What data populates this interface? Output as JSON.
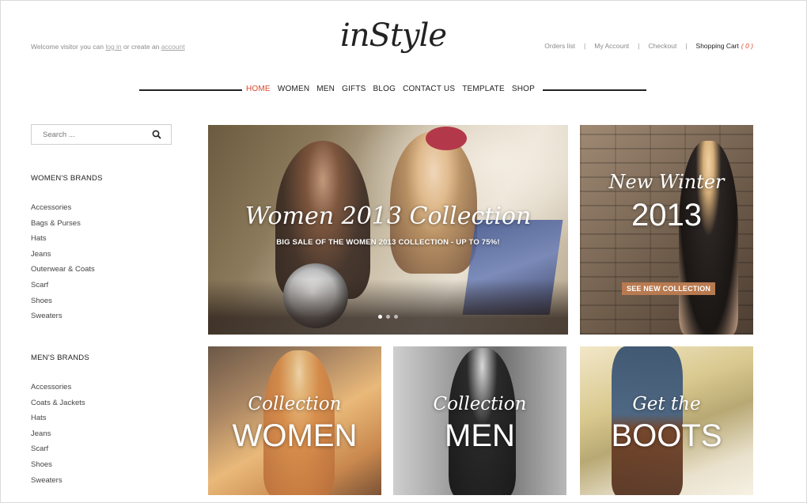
{
  "header": {
    "welcome": {
      "prefix": "Welcome visitor you can",
      "login": "log in",
      "middle": "or create an",
      "account": "account"
    },
    "logo": "inStyle",
    "links": {
      "orders": "Orders list",
      "my_account": "My Account",
      "checkout": "Checkout",
      "cart": "Shopping Cart",
      "cart_count": "( 0 )",
      "separator": "|"
    }
  },
  "nav": {
    "items": [
      "HOME",
      "WOMEN",
      "MEN",
      "GIFTS",
      "BLOG",
      "CONTACT US",
      "TEMPLATE",
      "SHOP"
    ],
    "active": "HOME"
  },
  "search": {
    "placeholder": "Search ..."
  },
  "sidebar": {
    "womens": {
      "heading": "WOMEN'S BRANDS",
      "items": [
        "Accessories",
        "Bags & Purses",
        "Hats",
        "Jeans",
        "Outerwear & Coats",
        "Scarf",
        "Shoes",
        "Sweaters"
      ]
    },
    "mens": {
      "heading": "MEN'S BRANDS",
      "items": [
        "Accessories",
        "Coats & Jackets",
        "Hats",
        "Jeans",
        "Scarf",
        "Shoes",
        "Sweaters"
      ]
    }
  },
  "hero": {
    "title": "Women 2013 Collection",
    "subtitle": "BIG SALE OF THE WOMEN 2013 COLLECTION - UP TO 75%!"
  },
  "promo_winter": {
    "script": "New Winter",
    "year": "2013",
    "badge": "SEE NEW COLLECTION"
  },
  "tiles": {
    "women": {
      "script": "Collection",
      "big": "WOMEN"
    },
    "men": {
      "script": "Collection",
      "big": "MEN"
    },
    "boots": {
      "script": "Get the",
      "big": "BOOTS"
    }
  },
  "colors": {
    "accent": "#d9472b",
    "badge": "#b87a50",
    "text": "#222222"
  }
}
